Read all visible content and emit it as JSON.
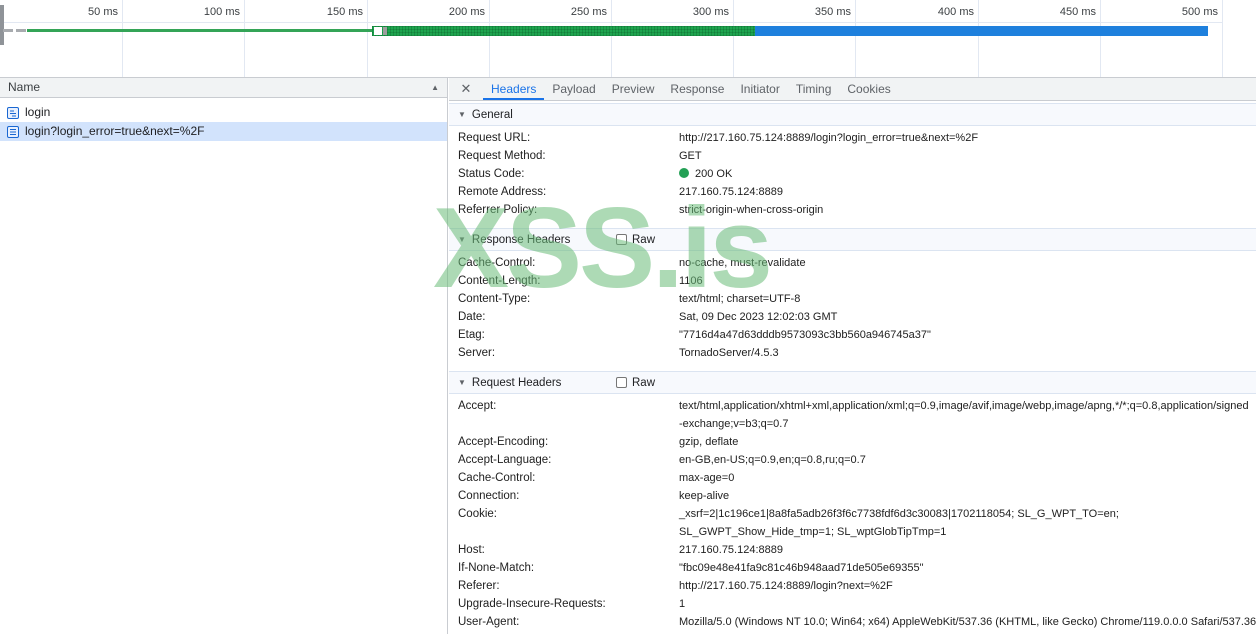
{
  "timeline": {
    "ticks": [
      "50 ms",
      "100 ms",
      "150 ms",
      "200 ms",
      "250 ms",
      "300 ms",
      "350 ms",
      "400 ms",
      "450 ms",
      "500 ms"
    ]
  },
  "network_list": {
    "column_header": "Name",
    "rows": [
      {
        "name": "login",
        "icon": "document-icon",
        "selected": false
      },
      {
        "name": "login?login_error=true&next=%2F",
        "icon": "document-icon",
        "selected": true
      }
    ]
  },
  "tabs": {
    "items": [
      {
        "label": "Headers",
        "active": true
      },
      {
        "label": "Payload",
        "active": false
      },
      {
        "label": "Preview",
        "active": false
      },
      {
        "label": "Response",
        "active": false
      },
      {
        "label": "Initiator",
        "active": false
      },
      {
        "label": "Timing",
        "active": false
      },
      {
        "label": "Cookies",
        "active": false
      }
    ]
  },
  "request_details": {
    "sections": [
      {
        "title": "General",
        "rows": [
          {
            "label": "Request URL:",
            "value": "http://217.160.75.124:8889/login?login_error=true&next=%2F"
          },
          {
            "label": "Request Method:",
            "value": "GET"
          },
          {
            "label": "Status Code:",
            "value": "200 OK",
            "status_dot": true
          },
          {
            "label": "Remote Address:",
            "value": "217.160.75.124:8889"
          },
          {
            "label": "Referrer Policy:",
            "value": "strict-origin-when-cross-origin"
          }
        ]
      },
      {
        "title": "Response Headers",
        "raw_label": "Raw",
        "rows": [
          {
            "label": "Cache-Control:",
            "value": "no-cache, must-revalidate"
          },
          {
            "label": "Content-Length:",
            "value": "1106"
          },
          {
            "label": "Content-Type:",
            "value": "text/html; charset=UTF-8"
          },
          {
            "label": "Date:",
            "value": "Sat, 09 Dec 2023 12:02:03 GMT"
          },
          {
            "label": "Etag:",
            "value": "\"7716d4a47d63dddb9573093c3bb560a946745a37\""
          },
          {
            "label": "Server:",
            "value": "TornadoServer/4.5.3"
          }
        ]
      },
      {
        "title": "Request Headers",
        "raw_label": "Raw",
        "rows": [
          {
            "label": "Accept:",
            "value": "text/html,application/xhtml+xml,application/xml;q=0.9,image/avif,image/webp,image/apng,*/*;q=0.8,application/signed-exchange;v=b3;q=0.7"
          },
          {
            "label": "Accept-Encoding:",
            "value": "gzip, deflate"
          },
          {
            "label": "Accept-Language:",
            "value": "en-GB,en-US;q=0.9,en;q=0.8,ru;q=0.7"
          },
          {
            "label": "Cache-Control:",
            "value": "max-age=0"
          },
          {
            "label": "Connection:",
            "value": "keep-alive"
          },
          {
            "label": "Cookie:",
            "value": "_xsrf=2|1c196ce1|8a8fa5adb26f3f6c7738fdf6d3c30083|1702118054; SL_G_WPT_TO=en; SL_GWPT_Show_Hide_tmp=1; SL_wptGlobTipTmp=1"
          },
          {
            "label": "Host:",
            "value": "217.160.75.124:8889"
          },
          {
            "label": "If-None-Match:",
            "value": "\"fbc09e48e41fa9c81c46b948aad71de505e69355\""
          },
          {
            "label": "Referer:",
            "value": "http://217.160.75.124:8889/login?next=%2F"
          },
          {
            "label": "Upgrade-Insecure-Requests:",
            "value": "1"
          },
          {
            "label": "User-Agent:",
            "value": "Mozilla/5.0 (Windows NT 10.0; Win64; x64) AppleWebKit/537.36 (KHTML, like Gecko) Chrome/119.0.0.0 Safari/537.36",
            "nowrap": true
          }
        ]
      }
    ]
  },
  "watermark": {
    "text": "XSS.is"
  },
  "icons": {
    "close": "✕",
    "sort_ascending": "▲",
    "section_expanded": "▼"
  },
  "colors": {
    "accent": "#1a73e8",
    "status_green": "#23a055",
    "bar_blue": "#1e80dd",
    "bar_green": "#1ea54f",
    "line_green": "#34a457",
    "selected_row": "#d2e3fc",
    "panel_gray": "#f1f3f4",
    "border_gray": "#c9ccd1",
    "section_bg": "#f7f9fd",
    "section_border": "#dbe4f1",
    "grid_line": "#e2e8f2",
    "watermark_green": "rgba(106,187,120,0.55)"
  }
}
